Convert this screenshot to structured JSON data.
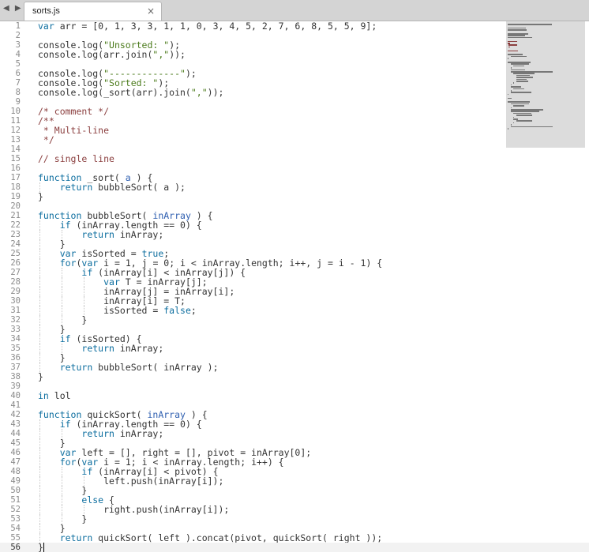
{
  "tab": {
    "title": "sorts.js",
    "close_glyph": "×",
    "nav_glyph": "◀ ▶"
  },
  "editor": {
    "lines": [
      {
        "n": "1",
        "text": "var arr = [0, 1, 3, 3, 1, 1, 0, 3, 4, 5, 2, 7, 6, 8, 5, 5, 9];"
      },
      {
        "n": "2",
        "text": ""
      },
      {
        "n": "3",
        "text": "console.log(\"Unsorted: \");"
      },
      {
        "n": "4",
        "text": "console.log(arr.join(\",\"));"
      },
      {
        "n": "5",
        "text": ""
      },
      {
        "n": "6",
        "text": "console.log(\"-------------\");"
      },
      {
        "n": "7",
        "text": "console.log(\"Sorted: \");"
      },
      {
        "n": "8",
        "text": "console.log(_sort(arr).join(\",\"));"
      },
      {
        "n": "9",
        "text": ""
      },
      {
        "n": "10",
        "text": "/* comment */"
      },
      {
        "n": "11",
        "text": "/**"
      },
      {
        "n": "12",
        "text": " * Multi-line"
      },
      {
        "n": "13",
        "text": " */"
      },
      {
        "n": "14",
        "text": ""
      },
      {
        "n": "15",
        "text": "// single line"
      },
      {
        "n": "16",
        "text": ""
      },
      {
        "n": "17",
        "text": "function _sort( a ) {"
      },
      {
        "n": "18",
        "text": "    return bubbleSort( a );"
      },
      {
        "n": "19",
        "text": "}"
      },
      {
        "n": "20",
        "text": ""
      },
      {
        "n": "21",
        "text": "function bubbleSort( inArray ) {"
      },
      {
        "n": "22",
        "text": "    if (inArray.length == 0) {"
      },
      {
        "n": "23",
        "text": "        return inArray;"
      },
      {
        "n": "24",
        "text": "    }"
      },
      {
        "n": "25",
        "text": "    var isSorted = true;"
      },
      {
        "n": "26",
        "text": "    for(var i = 1, j = 0; i < inArray.length; i++, j = i - 1) {"
      },
      {
        "n": "27",
        "text": "        if (inArray[i] < inArray[j]) {"
      },
      {
        "n": "28",
        "text": "            var T = inArray[j];"
      },
      {
        "n": "29",
        "text": "            inArray[j] = inArray[i];"
      },
      {
        "n": "30",
        "text": "            inArray[i] = T;"
      },
      {
        "n": "31",
        "text": "            isSorted = false;"
      },
      {
        "n": "32",
        "text": "        }"
      },
      {
        "n": "33",
        "text": "    }"
      },
      {
        "n": "34",
        "text": "    if (isSorted) {"
      },
      {
        "n": "35",
        "text": "        return inArray;"
      },
      {
        "n": "36",
        "text": "    }"
      },
      {
        "n": "37",
        "text": "    return bubbleSort( inArray );"
      },
      {
        "n": "38",
        "text": "}"
      },
      {
        "n": "39",
        "text": ""
      },
      {
        "n": "40",
        "text": "in lol"
      },
      {
        "n": "41",
        "text": ""
      },
      {
        "n": "42",
        "text": "function quickSort( inArray ) {"
      },
      {
        "n": "43",
        "text": "    if (inArray.length == 0) {"
      },
      {
        "n": "44",
        "text": "        return inArray;"
      },
      {
        "n": "45",
        "text": "    }"
      },
      {
        "n": "46",
        "text": "    var left = [], right = [], pivot = inArray[0];"
      },
      {
        "n": "47",
        "text": "    for(var i = 1; i < inArray.length; i++) {"
      },
      {
        "n": "48",
        "text": "        if (inArray[i] < pivot) {"
      },
      {
        "n": "49",
        "text": "            left.push(inArray[i]);"
      },
      {
        "n": "50",
        "text": "        }"
      },
      {
        "n": "51",
        "text": "        else {"
      },
      {
        "n": "52",
        "text": "            right.push(inArray[i]);"
      },
      {
        "n": "53",
        "text": "        }"
      },
      {
        "n": "54",
        "text": "    }"
      },
      {
        "n": "55",
        "text": "    return quickSort( left ).concat(pivot, quickSort( right ));"
      },
      {
        "n": "56",
        "text": "}"
      }
    ],
    "current_line": "56"
  },
  "colors": {
    "background": "#ffffff",
    "tabbar": "#d4d4d4",
    "line_number": "#8a8a8a",
    "keyword": "#0d6e9f",
    "string": "#4a7a1a",
    "comment": "#8b3f3f",
    "minimap": "#dcdcdc"
  }
}
